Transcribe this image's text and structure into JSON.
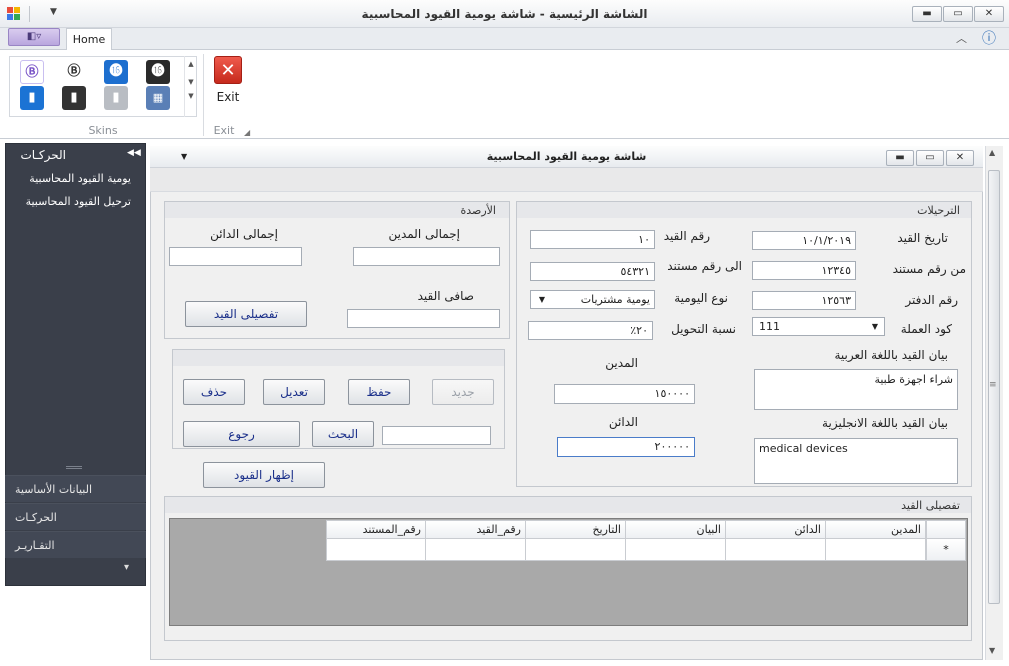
{
  "window": {
    "title": "الشاشة الرئيسية - شاشة يومية القيود المحاسبية",
    "minimize": "▬",
    "maximize": "▭",
    "close": "✕",
    "quick_access": "▼"
  },
  "ribbon": {
    "app_menu_icon": "◧▿",
    "tabs": [
      "Home"
    ],
    "skins_group_label": "Skins",
    "exit_group_label": "Exit",
    "exit_label": "Exit",
    "exit_icon": "✕",
    "help_icon": "ⓘ",
    "collapse_icon": "︿",
    "skin_icons": [
      "skin-2019-colorful-icon",
      "skin-2019-black-icon",
      "skin-2016-colorful-icon",
      "skin-2016-black-icon",
      "skin-office-blue-icon",
      "skin-office-black-icon",
      "skin-office-white-icon",
      "skin-gallery-icon"
    ]
  },
  "nav": {
    "header": "الحركـات",
    "collapse": "◀◀",
    "links": [
      "يومية القيود المحاسبية",
      "ترحيل القيود المحاسبية"
    ],
    "groups": [
      "البيانات الأساسية",
      "الحركـات",
      "التقـاريـر"
    ],
    "more": "▾"
  },
  "child": {
    "title": "شاشة يومية القيود المحاسبية",
    "menu": "▼",
    "minimize": "▬",
    "maximize": "▭",
    "close": "✕"
  },
  "postings": {
    "title": "الترحيلات",
    "entry_date_label": "تاريخ القيد",
    "entry_date": "١٠/١/٢٠١٩",
    "entry_no_label": "رقم القيد",
    "entry_no": "١٠",
    "from_doc_label": "من رقم مستند",
    "from_doc": "١٢٣٤٥",
    "to_doc_label": "الى رقم مستند",
    "to_doc": "٥٤٣٢١",
    "book_no_label": "رقم الدفتر",
    "book_no": "١٢٥٦٣",
    "journal_type_label": "نوع اليومية",
    "journal_type": "يومية مشتريات",
    "currency_label": "كود العملة",
    "currency": "111",
    "rate_label": "نسبة التحويل",
    "rate": "٢٠٪",
    "desc_ar_label": "بيان القيد باللغة العربية",
    "desc_ar": "شراء اجهزة طبية",
    "desc_en_label": "بيان القيد باللغة الانجليزية",
    "desc_en": "medical devices",
    "debit_label": "المدين",
    "debit": "١٥٠٠٠٠",
    "credit_label": "الدائن",
    "credit": "٢٠٠٠٠٠"
  },
  "balances": {
    "title": "الأرصدة",
    "total_debit_label": "إجمالى المدين",
    "total_credit_label": "إجمالى الدائن",
    "net_label": "صافى القيد",
    "details_button": "تفصيلى القيد"
  },
  "actions": {
    "new": "جديد",
    "save": "حفظ",
    "edit": "تعديل",
    "delete": "حذف",
    "search": "البحث",
    "back": "رجوع",
    "show_entries": "إظهار القيود",
    "search_value": ""
  },
  "details": {
    "title": "تفصيلى القيد",
    "columns": [
      "المدين",
      "الدائن",
      "البيان",
      "التاريخ",
      "رقم_القيد",
      "رقم_المستند"
    ],
    "new_row_marker": "*"
  }
}
